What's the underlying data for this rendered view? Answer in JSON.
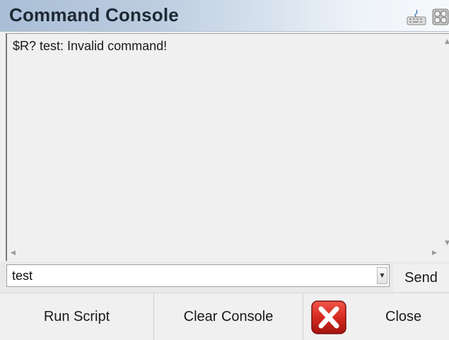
{
  "window": {
    "title": "Command Console",
    "toolbar_icons": [
      "keyboard-icon",
      "grid-icon"
    ]
  },
  "console": {
    "output_line": "$R? test: Invalid command!"
  },
  "command_input": {
    "value": "test"
  },
  "buttons": {
    "send": "Send",
    "run_script": "Run Script",
    "clear_console": "Clear Console",
    "close": "Close"
  },
  "colors": {
    "close_icon_red": "#d62a21",
    "title_text": "#1d2833",
    "background": "#f0f0f0"
  }
}
